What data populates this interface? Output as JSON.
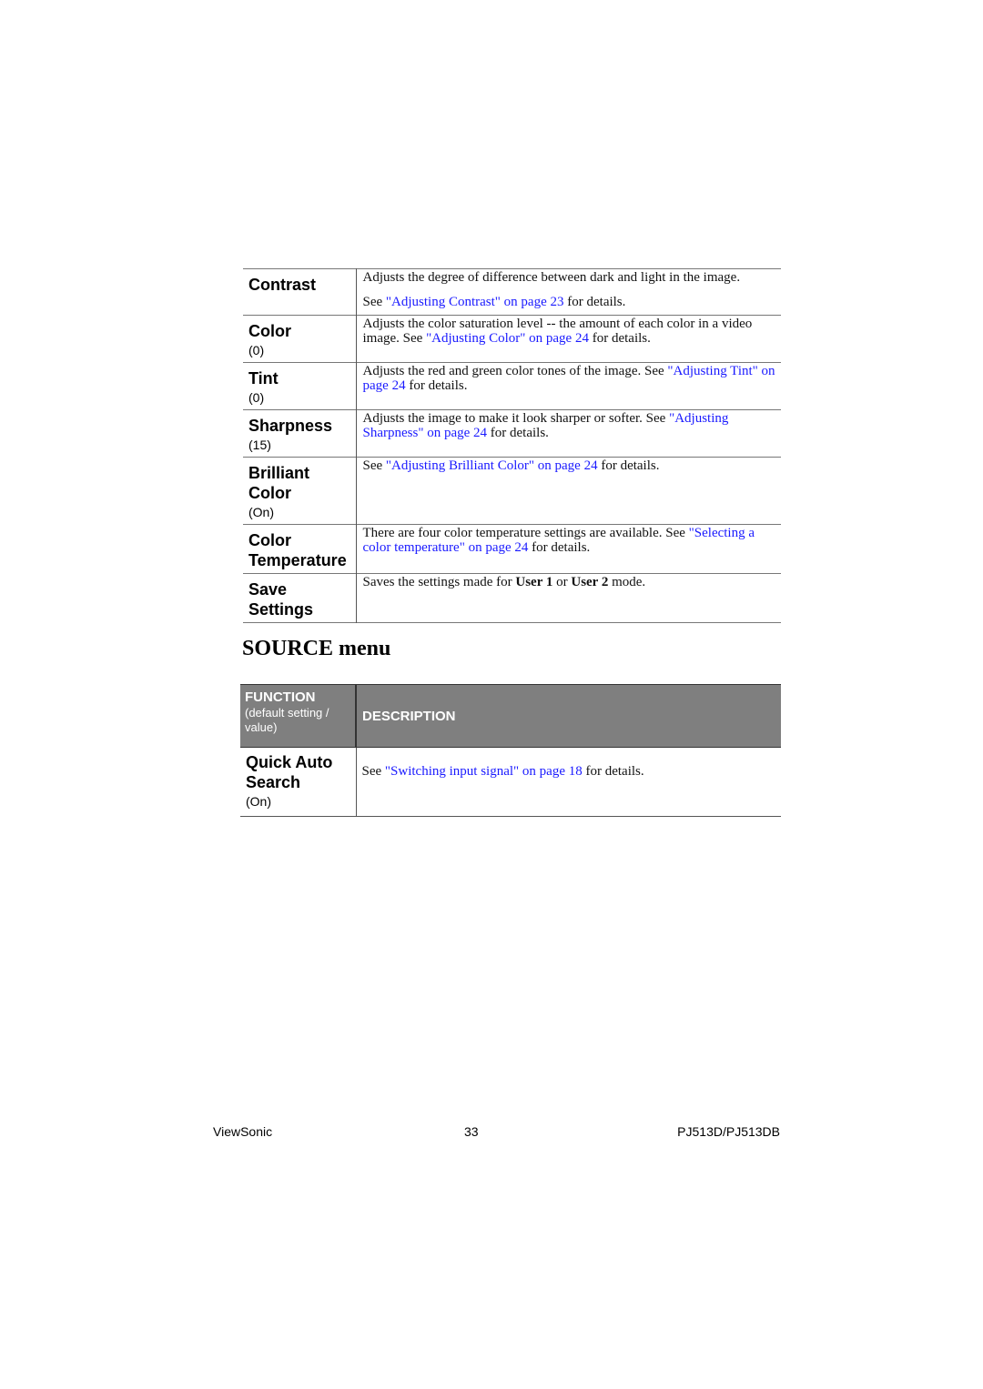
{
  "picture_table": {
    "rows": [
      {
        "name": "Contrast",
        "value": "",
        "desc_parts": [
          {
            "text": "Adjusts the degree of difference between dark and light in the image.",
            "type": "plain"
          }
        ],
        "desc2_parts": [
          {
            "text": "See ",
            "type": "plain"
          },
          {
            "text": "\"Adjusting Contrast\" on page 23",
            "type": "link"
          },
          {
            "text": " for details.",
            "type": "plain"
          }
        ]
      },
      {
        "name": "Color",
        "value": "(0)",
        "desc_parts": [
          {
            "text": "Adjusts the color saturation level -- the amount of each color in a video image. See ",
            "type": "plain"
          },
          {
            "text": "\"Adjusting Color\" on page 24",
            "type": "link"
          },
          {
            "text": " for details.",
            "type": "plain"
          }
        ]
      },
      {
        "name": "Tint",
        "value": "(0)",
        "desc_parts": [
          {
            "text": "Adjusts the red and green color tones of the image. See ",
            "type": "plain"
          },
          {
            "text": "\"Adjusting Tint\" on page 24",
            "type": "link"
          },
          {
            "text": " for details.",
            "type": "plain"
          }
        ]
      },
      {
        "name": "Sharpness",
        "value": "(15)",
        "desc_parts": [
          {
            "text": "Adjusts the image to make it look sharper or softer. See ",
            "type": "plain"
          },
          {
            "text": "\"Adjusting Sharpness\" on page 24",
            "type": "link"
          },
          {
            "text": " for details.",
            "type": "plain"
          }
        ]
      },
      {
        "name": "Brilliant Color",
        "value": "(On)",
        "desc_parts": [
          {
            "text": "See ",
            "type": "plain"
          },
          {
            "text": "\"Adjusting Brilliant Color\" on page 24",
            "type": "link"
          },
          {
            "text": " for details.",
            "type": "plain"
          }
        ]
      },
      {
        "name": "Color Temperature",
        "value": "",
        "desc_parts": [
          {
            "text": "There are four color temperature settings are available. See ",
            "type": "plain"
          },
          {
            "text": "\"Selecting a color temperature\" on page 24",
            "type": "link"
          },
          {
            "text": " for details.",
            "type": "plain"
          }
        ]
      },
      {
        "name": "Save Settings",
        "value": "",
        "desc_parts": [
          {
            "text": "Saves the settings made for ",
            "type": "plain"
          },
          {
            "text": "User 1",
            "type": "bold"
          },
          {
            "text": " or ",
            "type": "plain"
          },
          {
            "text": "User 2",
            "type": "bold"
          },
          {
            "text": " mode.",
            "type": "plain"
          }
        ]
      }
    ]
  },
  "source_section": {
    "title": "SOURCE menu",
    "header": {
      "function_label": "FUNCTION",
      "function_sub": "(default setting / value)",
      "description_label": "DESCRIPTION"
    },
    "rows": [
      {
        "name": "Quick Auto Search",
        "value": "(On)",
        "desc_parts": [
          {
            "text": "See ",
            "type": "plain"
          },
          {
            "text": "\"Switching input signal\" on page 18",
            "type": "link"
          },
          {
            "text": " for details.",
            "type": "plain"
          }
        ]
      }
    ]
  },
  "footer": {
    "brand": "ViewSonic",
    "page_number": "33",
    "model": "PJ513D/PJ513DB"
  },
  "colors": {
    "link": "#1a1aff",
    "header_bg": "#7f7f7f"
  }
}
